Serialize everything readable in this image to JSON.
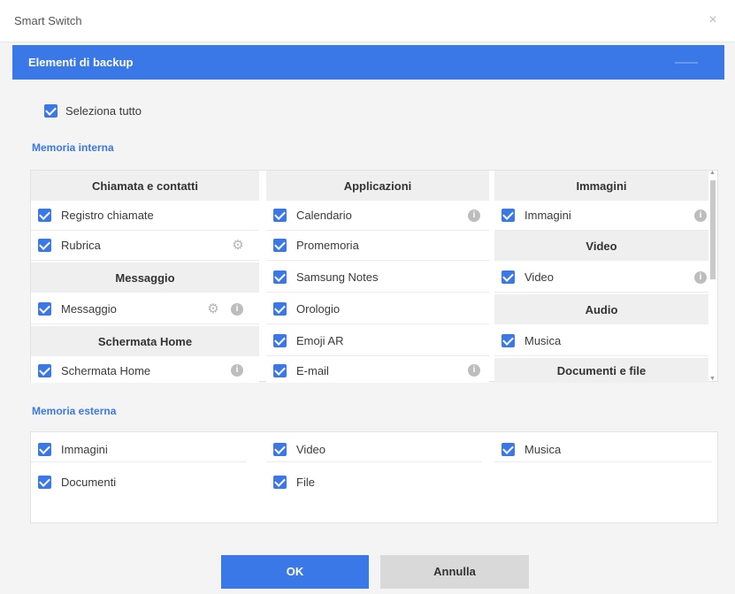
{
  "window": {
    "title": "Smart Switch",
    "close_glyph": "×"
  },
  "header": {
    "title": "Elementi di backup"
  },
  "select_all": {
    "label": "Seleziona tutto",
    "checked": true
  },
  "internal": {
    "section_title": "Memoria interna",
    "col1": {
      "calls_head": "Chiamata e contatti",
      "call_log": "Registro chiamate",
      "contacts": "Rubrica",
      "msg_head": "Messaggio",
      "messages": "Messaggio",
      "home_head": "Schermata Home",
      "home": "Schermata Home"
    },
    "col2": {
      "head": "Applicazioni",
      "calendar": "Calendario",
      "reminder": "Promemoria",
      "notes": "Samsung Notes",
      "clock": "Orologio",
      "emoji": "Emoji AR",
      "email": "E-mail"
    },
    "col3": {
      "img_head": "Immagini",
      "images": "Immagini",
      "video_head": "Video",
      "video": "Video",
      "audio_head": "Audio",
      "music": "Musica",
      "docs_head": "Documenti e file"
    }
  },
  "external": {
    "section_title": "Memoria esterna",
    "images": "Immagini",
    "video": "Video",
    "music": "Musica",
    "documents": "Documenti",
    "file": "File"
  },
  "icons": {
    "settings": "gear-icon",
    "info": "info-icon",
    "check": "checkbox-checked-icon"
  },
  "colors": {
    "accent": "#3b78e7",
    "section_header_bg": "#efefef",
    "cancel_bg": "#d9d9d9"
  },
  "buttons": {
    "ok": "OK",
    "cancel": "Annulla"
  }
}
